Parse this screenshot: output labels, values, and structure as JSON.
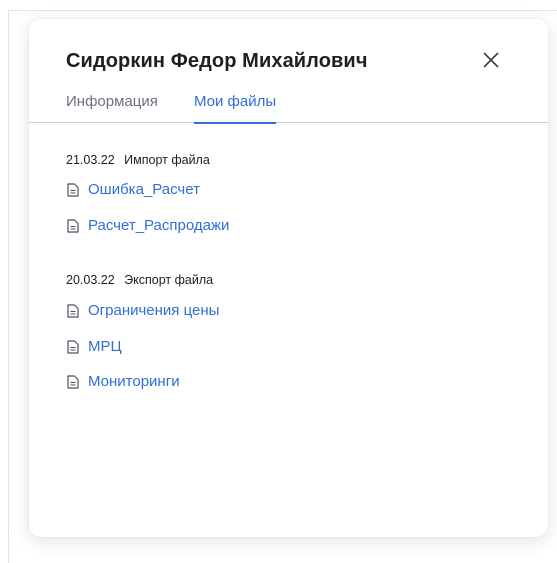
{
  "dialog": {
    "title": "Сидоркин Федор Михайлович",
    "close_icon": "close-icon"
  },
  "tabs": [
    {
      "label": "Информация",
      "active": false
    },
    {
      "label": "Мои файлы",
      "active": true
    }
  ],
  "groups": [
    {
      "date": "21.03.22",
      "action": "Импорт файла",
      "files": [
        "Ошибка_Расчет",
        "Расчет_Распродажи"
      ]
    },
    {
      "date": "20.03.22",
      "action": "Экспорт файла",
      "files": [
        "Ограничения цены",
        "МРЦ",
        "Мониторинги"
      ]
    }
  ],
  "colors": {
    "accent": "#2f6fd6",
    "text": "#1c1f24",
    "muted": "#6b7280"
  },
  "icons": {
    "file": "document-icon"
  }
}
